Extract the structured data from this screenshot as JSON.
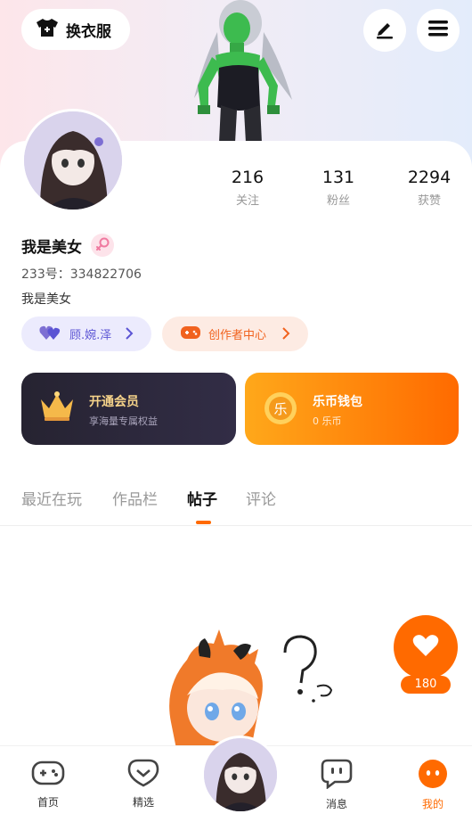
{
  "header": {
    "wardrobe_label": "换衣服"
  },
  "profile": {
    "stats": [
      {
        "value": "216",
        "label": "关注"
      },
      {
        "value": "131",
        "label": "粉丝"
      },
      {
        "value": "2294",
        "label": "获赞"
      }
    ],
    "username": "我是美女",
    "uid": "233号：334822706",
    "bio": "我是美女",
    "fan_pill_label": "顾.婉.泽",
    "creator_pill_label": "创作者中心"
  },
  "cards": {
    "vip_title": "开通会员",
    "vip_sub": "享海量专属权益",
    "wallet_title": "乐币钱包",
    "wallet_sub": "0 乐币",
    "wallet_coin_glyph": "乐"
  },
  "tabs": [
    "最近在玩",
    "作品栏",
    "帖子",
    "评论"
  ],
  "active_tab": "帖子",
  "like_count": "180",
  "nav": {
    "items": [
      {
        "label": "首页",
        "icon": "gamepad-icon"
      },
      {
        "label": "精选",
        "icon": "heart-bubble-icon"
      },
      {
        "label": "消息",
        "icon": "message-icon"
      },
      {
        "label": "我的",
        "icon": "me-icon"
      }
    ]
  },
  "colors": {
    "accent": "#ff6a00",
    "fan_pill_text": "#5b54d4",
    "vip_gold": "#f7d48a"
  }
}
